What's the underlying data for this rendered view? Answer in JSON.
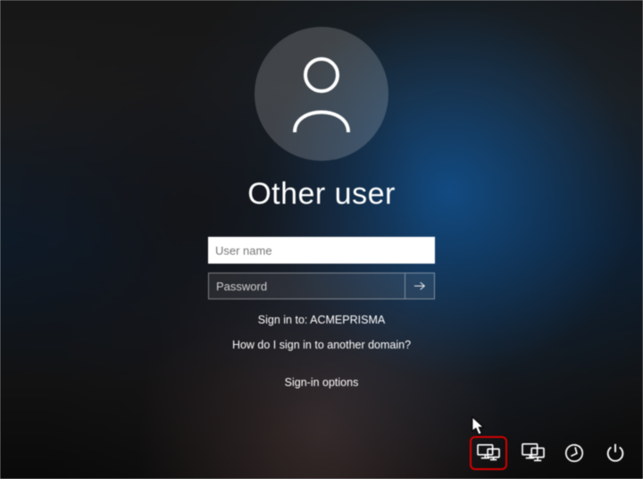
{
  "login": {
    "title": "Other user",
    "username_placeholder": "User name",
    "password_placeholder": "Password",
    "sign_in_to_prefix": "Sign in to: ",
    "domain": "ACMEPRISMA",
    "domain_help": "How do I sign in to another domain?",
    "signin_options": "Sign-in options"
  },
  "icons": {
    "avatar": "user-icon",
    "submit": "arrow-right-icon",
    "network": "network-icon",
    "display": "display-icon",
    "ease_of_access": "ease-of-access-icon",
    "power": "power-icon"
  }
}
